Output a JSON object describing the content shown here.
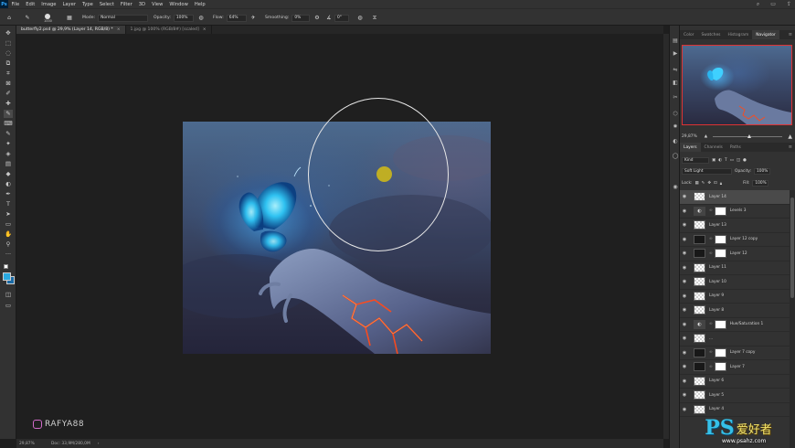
{
  "app": {
    "logo_label": "Ps"
  },
  "menu": [
    "File",
    "Edit",
    "Image",
    "Layer",
    "Type",
    "Select",
    "Filter",
    "3D",
    "View",
    "Window",
    "Help"
  ],
  "window_controls": {
    "search": "⌕",
    "arrange": "▭",
    "share": "⇪"
  },
  "options": {
    "brush_size": "1000",
    "mode_label": "Mode:",
    "mode_value": "Normal",
    "opacity_label": "Opacity:",
    "opacity_value": "100%",
    "flow_label": "Flow:",
    "flow_value": "64%",
    "smoothing_label": "Smoothing:",
    "smoothing_value": "0%",
    "angle_value": "0°"
  },
  "tabs": [
    {
      "label": "butterfly2.psd @ 29,9% (Layer 14, RGB/8) *",
      "close": "×"
    },
    {
      "label": "1.jpg @ 100% (RGB/8#) [scaled]",
      "close": "×"
    }
  ],
  "tools": [
    "✥",
    "⬚",
    "◌",
    "⧉",
    "⌗",
    "⊠",
    "✐",
    "✚",
    "✎",
    "⌨",
    "✎",
    "✦",
    "◈",
    "▤",
    "◆",
    "◐",
    "✒",
    "T",
    "➤",
    "▭",
    "✋",
    "⚲",
    "···"
  ],
  "status": {
    "zoom": "29,87%",
    "doc": "Doc: 33,9M/280,0M",
    "arrow": "›"
  },
  "watermark": "RAFYA88",
  "panels": {
    "top_tabs": [
      "Color",
      "Swatches",
      "Histogram",
      "Navigator"
    ],
    "top_active": 3,
    "navigator_zoom": "29,87%",
    "layer_tabs": [
      "Layers",
      "Channels",
      "Paths"
    ],
    "layer_active": 0,
    "filter_kind": "Kind",
    "blend_mode": "Soft Light",
    "opacity_label": "Opacity:",
    "opacity_value": "100%",
    "lock_label": "Lock:",
    "fill_label": "Fill:",
    "fill_value": "100%",
    "menu_glyph": "≡"
  },
  "layers": [
    {
      "name": "Layer 14",
      "type": "checker",
      "selected": true
    },
    {
      "name": "Levels 3",
      "type": "adjustment"
    },
    {
      "name": "Layer 13",
      "type": "checker"
    },
    {
      "name": "Layer 12 copy",
      "type": "dark"
    },
    {
      "name": "Layer 12",
      "type": "dark"
    },
    {
      "name": "Layer 11",
      "type": "checker"
    },
    {
      "name": "Layer 10",
      "type": "checker"
    },
    {
      "name": "Layer 9",
      "type": "checker"
    },
    {
      "name": "Layer 8",
      "type": "checker"
    },
    {
      "name": "Hue/Saturation 1",
      "type": "adjustment"
    },
    {
      "name": "...",
      "type": "checker"
    },
    {
      "name": "Layer 7 copy",
      "type": "dark"
    },
    {
      "name": "Layer 7",
      "type": "dark"
    },
    {
      "name": "Layer 6",
      "type": "checker"
    },
    {
      "name": "Layer 5",
      "type": "checker"
    },
    {
      "name": "Layer 4",
      "type": "checker"
    }
  ],
  "badge": {
    "main": "PS",
    "cn": "爱好者",
    "url": "www.psahz.com"
  }
}
